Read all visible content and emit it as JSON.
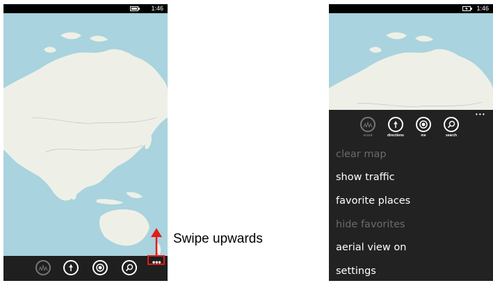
{
  "left_phone": {
    "status": {
      "time": "1:46"
    },
    "appbar": {
      "more": "•••"
    }
  },
  "annotation": {
    "label": "Swipe upwards"
  },
  "right_phone": {
    "status": {
      "time": "1:46"
    },
    "appbar": {
      "more": "• • •",
      "buttons": [
        {
          "label": "scout",
          "icon": "scout-icon",
          "enabled": false
        },
        {
          "label": "directions",
          "icon": "directions-icon",
          "enabled": true
        },
        {
          "label": "me",
          "icon": "me-icon",
          "enabled": true
        },
        {
          "label": "search",
          "icon": "search-icon",
          "enabled": true
        }
      ]
    },
    "menu": [
      {
        "label": "clear map",
        "enabled": false
      },
      {
        "label": "show traffic",
        "enabled": true
      },
      {
        "label": "favorite places",
        "enabled": true
      },
      {
        "label": "hide favorites",
        "enabled": false
      },
      {
        "label": "aerial view on",
        "enabled": true
      },
      {
        "label": "settings",
        "enabled": true
      }
    ]
  },
  "colors": {
    "water": "#a9d3de",
    "land": "#eef0e7",
    "appbar": "#1f1f1f",
    "accent": "#e31b1b"
  }
}
